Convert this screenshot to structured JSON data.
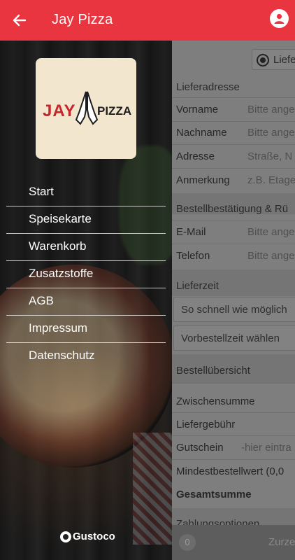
{
  "appbar": {
    "title": "Jay Pizza"
  },
  "logo": {
    "word1": "JAY",
    "word2": "PIZZA"
  },
  "menu": [
    {
      "label": "Start"
    },
    {
      "label": "Speisekarte"
    },
    {
      "label": "Warenkorb"
    },
    {
      "label": "Zusatzstoffe"
    },
    {
      "label": "AGB"
    },
    {
      "label": "Impressum"
    },
    {
      "label": "Datenschutz"
    }
  ],
  "footer": {
    "brand": "Gustoco"
  },
  "form": {
    "delivery_option": "Liefe",
    "address_section": "Lieferadresse",
    "fields": [
      {
        "label": "Vorname",
        "placeholder": "Bitte ange"
      },
      {
        "label": "Nachname",
        "placeholder": "Bitte ange"
      },
      {
        "label": "Adresse",
        "placeholder": "Straße, N"
      },
      {
        "label": "Anmerkung",
        "placeholder": "z.B. Etage"
      }
    ],
    "confirm_section": "Bestellbestätigung & Rü",
    "contact_fields": [
      {
        "label": "E-Mail",
        "placeholder": "Bitte ange"
      },
      {
        "label": "Telefon",
        "placeholder": "Bitte ange"
      }
    ],
    "time_section": "Lieferzeit",
    "time_options": [
      "So schnell wie möglich",
      "Vorbestellzeit wählen"
    ],
    "overview_section": "Bestellübersicht",
    "subtotal": "Zwischensumme",
    "delivery_fee": "Liefergebühr",
    "voucher_label": "Gutschein",
    "voucher_placeholder": "-hier eintra",
    "minimum": "Mindestbestellwert (0,0",
    "total": "Gesamtsumme",
    "payment_section": "Zahlungsoptionen",
    "cart_count": "0",
    "bottom_action": "Zurze"
  }
}
